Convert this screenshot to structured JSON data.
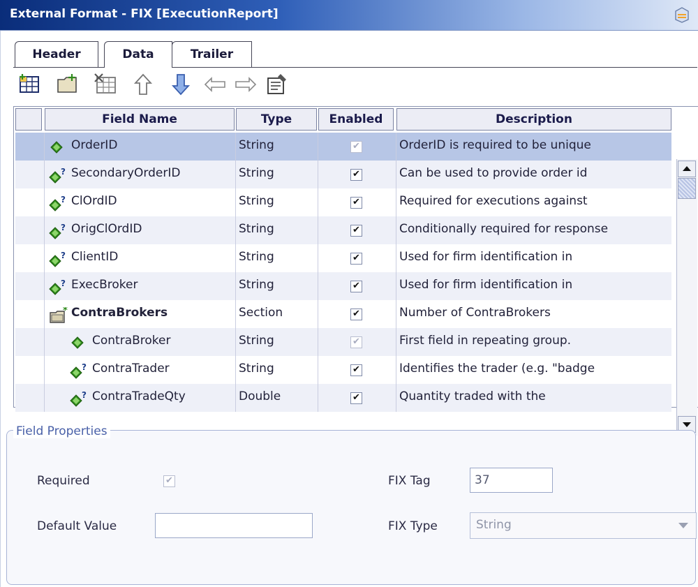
{
  "window": {
    "title": "External Format - FIX [ExecutionReport]"
  },
  "tabs": [
    {
      "label": "Header"
    },
    {
      "label": "Data",
      "selected": true
    },
    {
      "label": "Trailer"
    }
  ],
  "toolbar": {
    "buttons": [
      "add-field-icon",
      "add-section-icon",
      "delete-field-icon",
      "move-up-icon",
      "move-down-icon",
      "outdent-icon",
      "indent-icon",
      "properties-icon"
    ]
  },
  "grid": {
    "columns": [
      "Field Name",
      "Type",
      "Enabled",
      "Description"
    ],
    "rows": [
      {
        "name": "OrderID",
        "type": "String",
        "enabled": "✔",
        "enabled_disabled": true,
        "description": "OrderID is required to be unique",
        "icon": "required-field-icon",
        "indent": 0,
        "selected": true
      },
      {
        "name": "SecondaryOrderID",
        "type": "String",
        "enabled": "✔",
        "description": "Can be used to provide order id",
        "icon": "optional-field-icon",
        "indent": 0
      },
      {
        "name": "ClOrdID",
        "type": "String",
        "enabled": "✔",
        "description": "Required for executions against",
        "icon": "optional-field-icon",
        "indent": 0
      },
      {
        "name": "OrigClOrdID",
        "type": "String",
        "enabled": "✔",
        "description": "Conditionally required for response",
        "icon": "optional-field-icon",
        "indent": 0
      },
      {
        "name": "ClientID",
        "type": "String",
        "enabled": "✔",
        "description": "Used for firm identification in",
        "icon": "optional-field-icon",
        "indent": 0
      },
      {
        "name": "ExecBroker",
        "type": "String",
        "enabled": "✔",
        "description": "Used for firm identification in",
        "icon": "optional-field-icon",
        "indent": 0
      },
      {
        "name": "ContraBrokers",
        "type": "Section",
        "enabled": "✔",
        "description": "Number of ContraBrokers",
        "icon": "section-icon",
        "indent": 0,
        "bold": true
      },
      {
        "name": "ContraBroker",
        "type": "String",
        "enabled": "✔",
        "enabled_disabled": true,
        "description": "First field in repeating group.",
        "icon": "required-field-icon",
        "indent": 1
      },
      {
        "name": "ContraTrader",
        "type": "String",
        "enabled": "✔",
        "description": "Identifies the trader (e.g. \"badge",
        "icon": "optional-field-icon",
        "indent": 1
      },
      {
        "name": "ContraTradeQty",
        "type": "Double",
        "enabled": "✔",
        "description": "Quantity traded with the",
        "icon": "optional-field-icon",
        "indent": 1
      }
    ]
  },
  "field_properties": {
    "legend": "Field Properties",
    "required_label": "Required",
    "required_check": "✔",
    "default_value_label": "Default Value",
    "default_value": "",
    "fix_tag_label": "FIX Tag",
    "fix_tag_value": "37",
    "fix_type_label": "FIX Type",
    "fix_type_value": "String"
  },
  "colors": {
    "title_bar": "#0a2d7a",
    "selected_row": "#b7c6e6",
    "required_icon": "#2f8a1c",
    "optional_marker": "#f0b000"
  }
}
